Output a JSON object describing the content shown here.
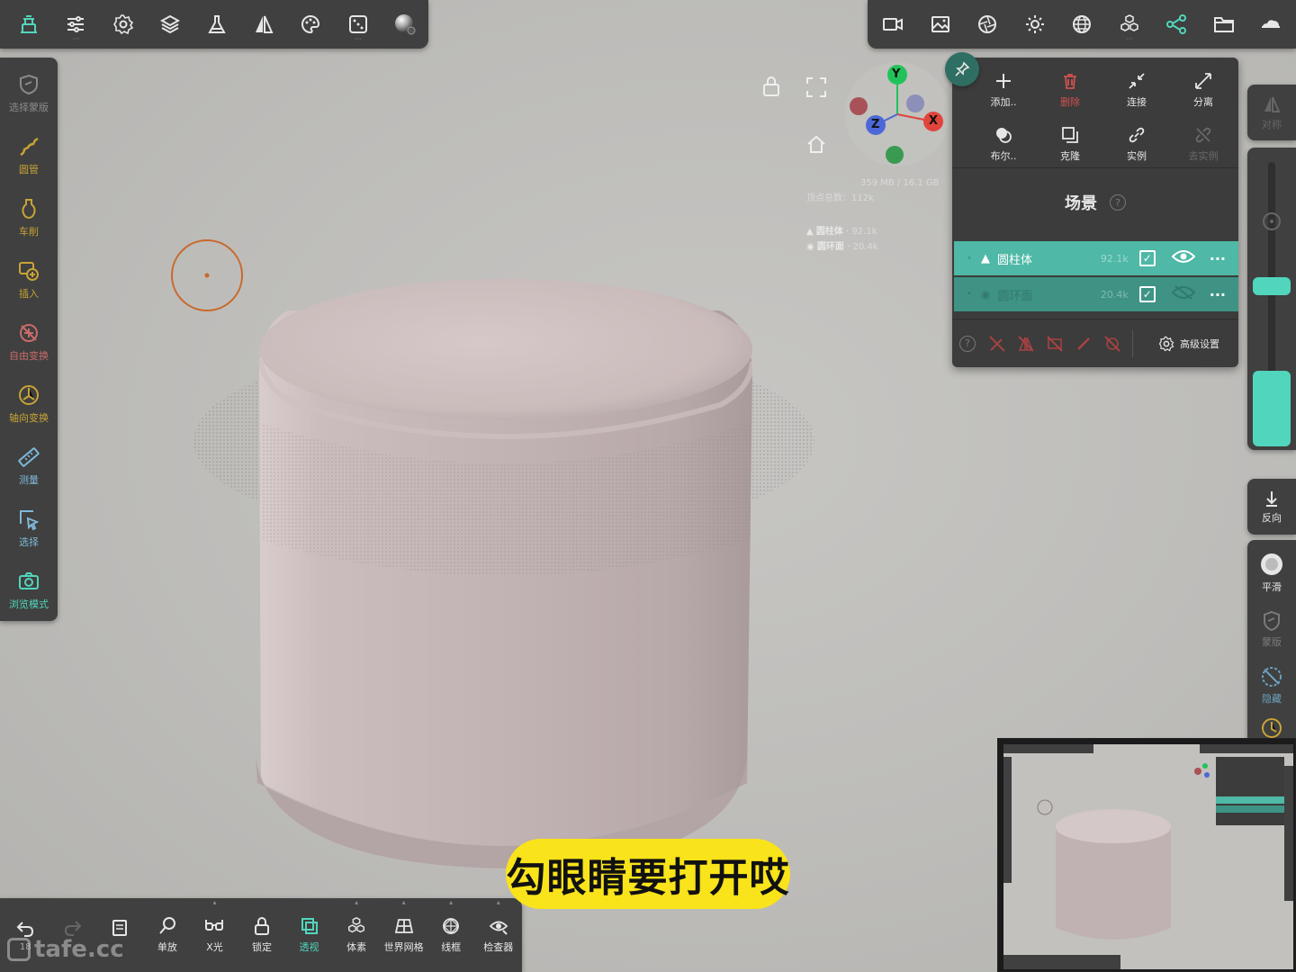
{
  "colors": {
    "accent": "#52d5bd",
    "toolbar_bg": "#3f403f",
    "viewport_bg": "#bdbcb9",
    "object_color": "#c1b2b2",
    "subtitle_bg": "#f9e31a",
    "cursor_ring": "#c8692c",
    "axis_x": "#e0443c",
    "axis_y": "#22c25a",
    "axis_z": "#4c68d8",
    "icon_gold": "#c9a337"
  },
  "top_left_toolbar": {
    "icons": [
      "scene-gallery-icon",
      "sliders-icon",
      "settings-gear-icon",
      "layers-icon",
      "flask-icon",
      "symmetry-icon",
      "palette-icon",
      "dice-icon",
      "matcap-sphere-icon"
    ]
  },
  "top_right_toolbar": {
    "icons": [
      "video-camera-icon",
      "image-icon",
      "aperture-icon",
      "sun-icon",
      "globe-icon",
      "cube-group-icon",
      "scene-graph-icon",
      "folder-icon",
      "cloud-icon"
    ]
  },
  "left_sidebar": {
    "items": [
      {
        "icon": "mask-select-icon",
        "label": "选择蒙版",
        "color": "#8a8a8a"
      },
      {
        "icon": "tube-icon",
        "label": "圆管",
        "color": "#c9a337"
      },
      {
        "icon": "lathe-icon",
        "label": "车削",
        "color": "#c9a337"
      },
      {
        "icon": "insert-icon",
        "label": "插入",
        "color": "#c9a337"
      },
      {
        "icon": "free-transform-icon",
        "label": "自由变换",
        "color": "#c96b6b"
      },
      {
        "icon": "axis-transform-icon",
        "label": "轴向变换",
        "color": "#c9a337"
      },
      {
        "icon": "ruler-icon",
        "label": "测量",
        "color": "#7fb8d8"
      },
      {
        "icon": "select-icon",
        "label": "选择",
        "color": "#7fb8d8"
      },
      {
        "icon": "camera-icon",
        "label": "浏览模式",
        "color": "#52d5bd"
      }
    ]
  },
  "right_sidebar": {
    "symmetry_label": "对称",
    "reverse_label": "反向",
    "smooth_label": "平滑",
    "mask_label": "蒙版",
    "hide_label": "隐藏"
  },
  "scene_panel": {
    "actions": [
      {
        "icon": "plus-icon",
        "label": "添加..",
        "color": "#e6e6e6"
      },
      {
        "icon": "trash-icon",
        "label": "删除",
        "color": "#d05050"
      },
      {
        "icon": "merge-icon",
        "label": "连接",
        "color": "#e6e6e6"
      },
      {
        "icon": "split-icon",
        "label": "分离",
        "color": "#e6e6e6"
      },
      {
        "icon": "boolean-icon",
        "label": "布尔..",
        "color": "#e6e6e6"
      },
      {
        "icon": "clone-icon",
        "label": "克隆",
        "color": "#e6e6e6"
      },
      {
        "icon": "instance-link-icon",
        "label": "实例",
        "color": "#e6e6e6"
      },
      {
        "icon": "unlink-icon",
        "label": "去实例",
        "color": "#6a6a6a"
      }
    ],
    "title": "场景",
    "rows": [
      {
        "name": "圆柱体",
        "count": "92.1k",
        "visible": true
      },
      {
        "name": "圆环面",
        "count": "20.4k",
        "visible": false
      }
    ],
    "advanced_label": "高级设置"
  },
  "stats": {
    "memory": "359 MB / 16.1 GB",
    "vertices_label": "顶点总数：112k",
    "objects": [
      {
        "name": "圆柱体",
        "count": "92.1k"
      },
      {
        "name": "圆环面",
        "count": "20.4k"
      }
    ]
  },
  "gizmo": {
    "x_label": "X",
    "y_label": "Y",
    "z_label": "Z"
  },
  "bottom_bar": {
    "undo_count": "18",
    "items": [
      {
        "icon": "undo-icon",
        "label": ""
      },
      {
        "icon": "redo-icon",
        "label": ""
      },
      {
        "icon": "book-icon",
        "label": ""
      },
      {
        "icon": "zoom-single-icon",
        "label": "单放"
      },
      {
        "icon": "xray-glasses-icon",
        "label": "X光"
      },
      {
        "icon": "lock-icon",
        "label": "锁定"
      },
      {
        "icon": "transparency-icon",
        "label": "透视"
      },
      {
        "icon": "voxel-icon",
        "label": "体素"
      },
      {
        "icon": "world-grid-icon",
        "label": "世界网格"
      },
      {
        "icon": "wireframe-icon",
        "label": "线框"
      },
      {
        "icon": "inspector-eye-icon",
        "label": "检查器"
      }
    ]
  },
  "watermark": "tafe.cc",
  "subtitle": "勾眼睛要打开哎"
}
